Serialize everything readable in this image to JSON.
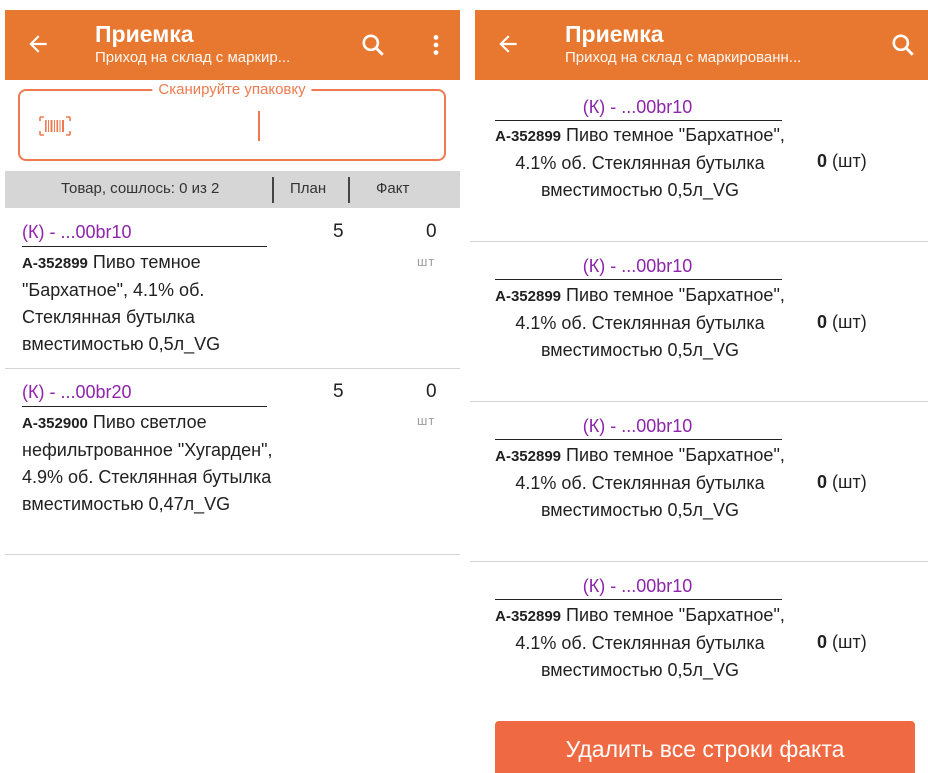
{
  "left": {
    "header": {
      "title": "Приемка",
      "subtitle": "Приход на склад с маркир..."
    },
    "scan": {
      "legend": "Сканируйте упаковку"
    },
    "columns": {
      "item": "Товар, сошлось: 0 из 2",
      "plan": "План",
      "fact": "Факт"
    },
    "rows": [
      {
        "code": "(К) - ...00br10",
        "sku": "А-352899",
        "name": "Пиво темное \"Бархатное\", 4.1% об. Стеклянная бутылка вместимостью 0,5л_VG",
        "plan": "5",
        "fact": "0",
        "unit": "шт"
      },
      {
        "code": "(К) - ...00br20",
        "sku": "А-352900",
        "name": "Пиво светлое нефильтрованное \"Хугарден\", 4.9% об. Стеклянная бутылка вместимостью 0,47л_VG",
        "plan": "5",
        "fact": "0",
        "unit": "шт"
      }
    ]
  },
  "right": {
    "header": {
      "title": "Приемка",
      "subtitle": "Приход на склад с маркированн..."
    },
    "rows": [
      {
        "code": "(К) - ...00br10",
        "sku": "А-352899",
        "name": "Пиво темное \"Бархатное\", 4.1% об. Стеклянная бутылка вместимостью 0,5л_VG",
        "qty": "0",
        "unit": "(шт)"
      },
      {
        "code": "(К) - ...00br10",
        "sku": "А-352899",
        "name": "Пиво темное \"Бархатное\", 4.1% об. Стеклянная бутылка вместимостью 0,5л_VG",
        "qty": "0",
        "unit": "(шт)"
      },
      {
        "code": "(К) - ...00br10",
        "sku": "А-352899",
        "name": "Пиво темное \"Бархатное\", 4.1% об. Стеклянная бутылка вместимостью 0,5л_VG",
        "qty": "0",
        "unit": "(шт)"
      },
      {
        "code": "(К) - ...00br10",
        "sku": "А-352899",
        "name": "Пиво темное \"Бархатное\", 4.1% об. Стеклянная бутылка вместимостью 0,5л_VG",
        "qty": "0",
        "unit": "(шт)"
      }
    ],
    "delete_button": "Удалить все строки факта"
  },
  "colors": {
    "accent": "#e8782f",
    "code": "#8e24aa",
    "button": "#ef6a42"
  },
  "icons": [
    "back-arrow-icon",
    "search-icon",
    "more-vert-icon",
    "barcode-icon"
  ]
}
